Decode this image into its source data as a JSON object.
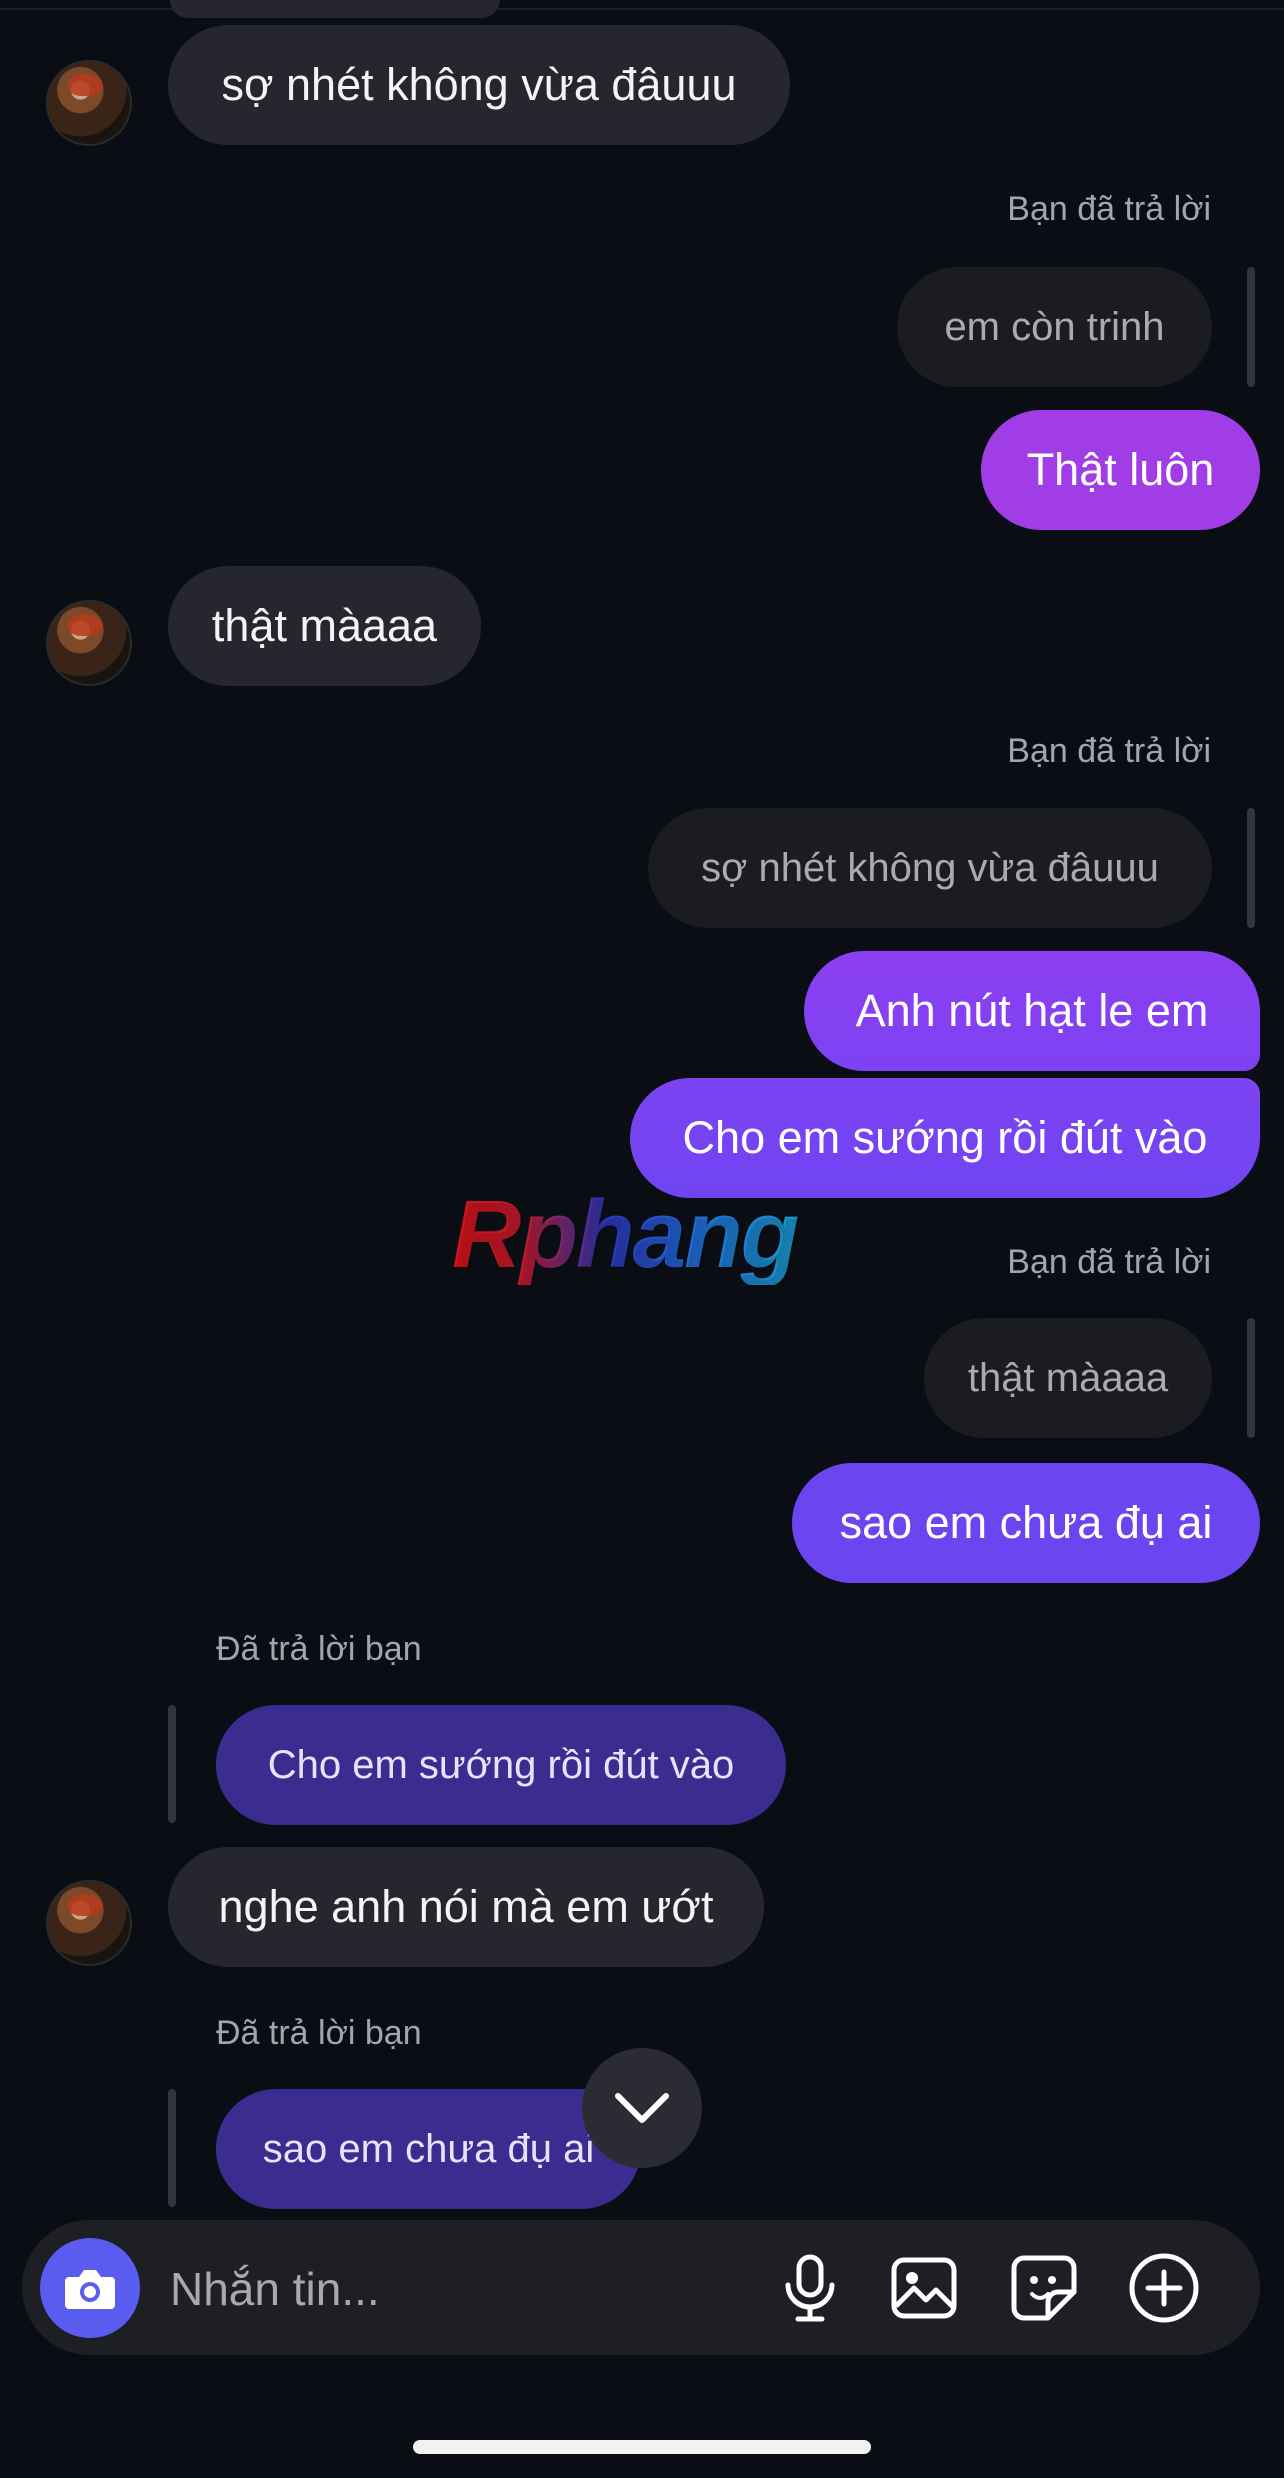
{
  "conversation": {
    "msg_1": "sợ nhét không vừa đâuuu",
    "reply_label_1": "Bạn đã trả lời",
    "quote_1": "em còn trinh",
    "msg_2": "Thật luôn",
    "msg_3": "thật màaaa",
    "reply_label_2": "Bạn đã trả lời",
    "quote_2": "sợ nhét không vừa đâuuu",
    "msg_4": "Anh nút hạt le em",
    "msg_5": "Cho em sướng rồi đút vào",
    "reply_label_3": "Bạn đã trả lời",
    "quote_3": "thật màaaa",
    "msg_6": "sao em chưa đụ ai",
    "reply_label_4": "Đã trả lời bạn",
    "quote_4": "Cho em sướng rồi đút vào",
    "msg_7": "nghe anh nói mà em ướt",
    "reply_label_5": "Đã trả lời bạn",
    "quote_5": "sao em chưa đụ ai"
  },
  "watermark": "Rphang",
  "composer": {
    "placeholder": "Nhắn tin...",
    "icons": [
      "camera-icon",
      "microphone-icon",
      "gallery-icon",
      "sticker-icon",
      "plus-icon"
    ]
  },
  "colors": {
    "background": "#0b0d14",
    "incoming_bubble": "#26272e",
    "outgoing_gradient": [
      "#a23de6",
      "#6b45f0"
    ],
    "camera_button": "#5a5cf0",
    "incoming_quote": "#3b2d8f"
  }
}
